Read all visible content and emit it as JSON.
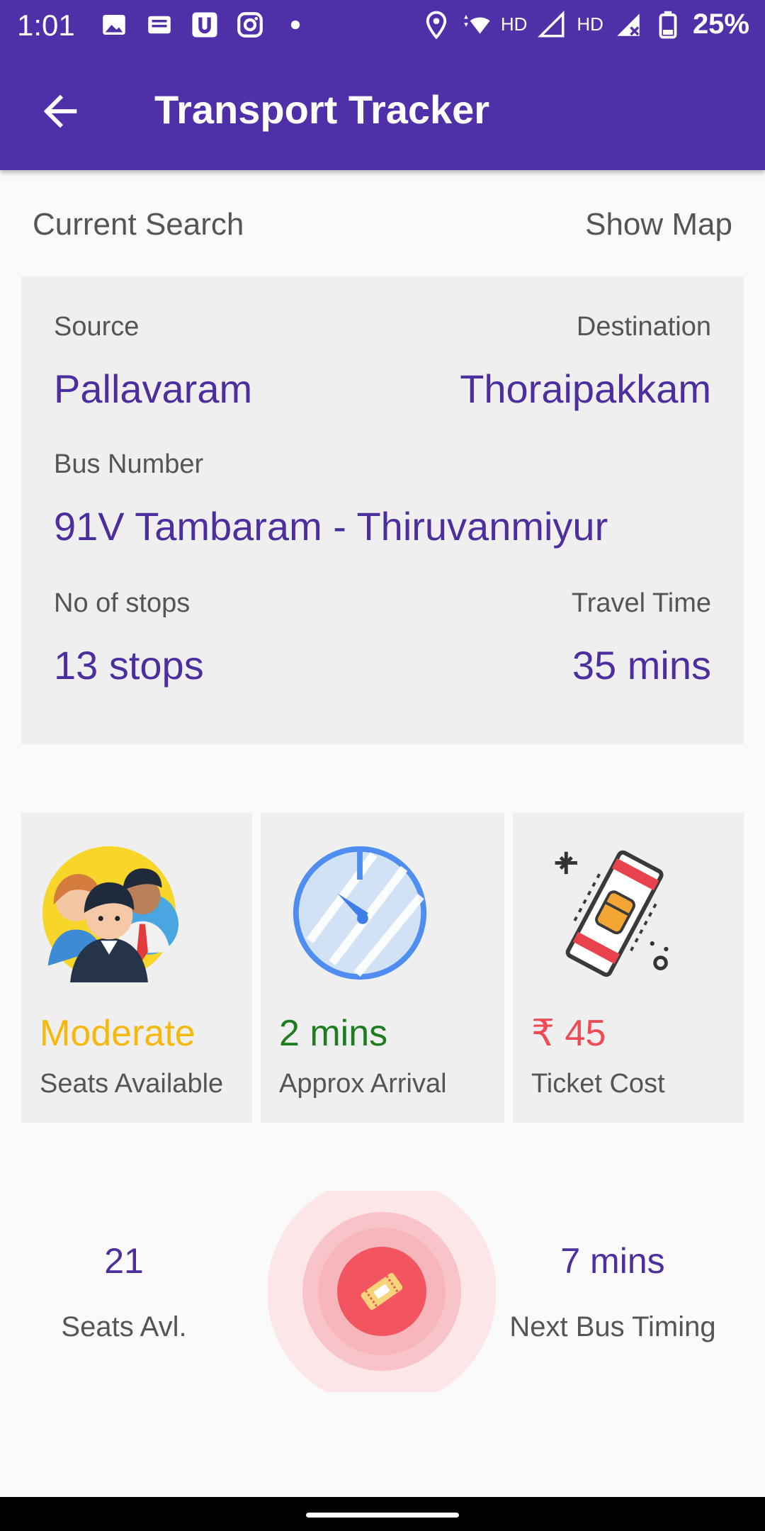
{
  "status_bar": {
    "time": "1:01",
    "battery": "25%",
    "network_label_1": "HD",
    "network_label_2": "HD"
  },
  "app_bar": {
    "title": "Transport Tracker"
  },
  "header": {
    "current_search": "Current Search",
    "show_map": "Show Map"
  },
  "route": {
    "source_label": "Source",
    "source_value": "Pallavaram",
    "destination_label": "Destination",
    "destination_value": "Thoraipakkam",
    "bus_number_label": "Bus Number",
    "bus_number_value": "91V Tambaram - Thiruvanmiyur",
    "stops_label": "No of stops",
    "stops_value": "13 stops",
    "travel_time_label": "Travel Time",
    "travel_time_value": "35 mins"
  },
  "tiles": [
    {
      "icon": "people-icon",
      "value": "Moderate",
      "label": "Seats Available",
      "color": "#f6b80c"
    },
    {
      "icon": "stopwatch-icon",
      "value": "2 mins",
      "label": "Approx Arrival",
      "color": "#1e7d1e"
    },
    {
      "icon": "ticket-icon",
      "value": "₹ 45",
      "label": "Ticket Cost",
      "color": "#ee4b55"
    }
  ],
  "bottom": {
    "seats_value": "21",
    "seats_label": "Seats Avl.",
    "next_bus_value": "7 mins",
    "next_bus_label": "Next Bus Timing"
  },
  "colors": {
    "primary": "#5030a8",
    "accent_text": "#4d2e9e",
    "fab": "#f25560"
  }
}
